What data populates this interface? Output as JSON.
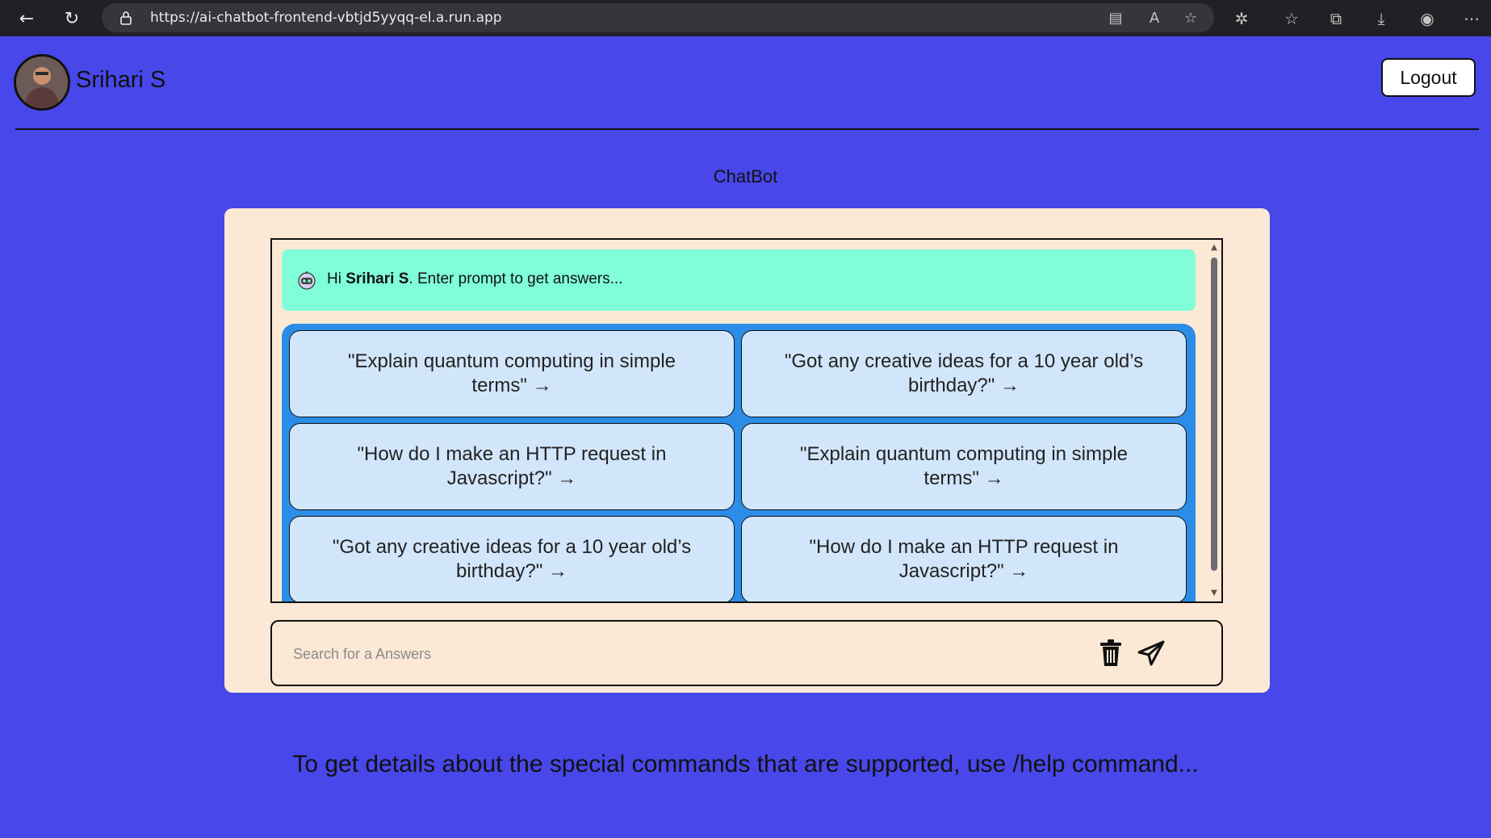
{
  "browser": {
    "url": "https://ai-chatbot-frontend-vbtjd5yyqq-el.a.run.app"
  },
  "header": {
    "user_name": "Srihari S",
    "logout_label": "Logout"
  },
  "page": {
    "title": "ChatBot",
    "help_text": "To get details about the special commands that are supported, use /help command..."
  },
  "chat": {
    "greeting_prefix": "Hi ",
    "greeting_name": "Srihari S",
    "greeting_suffix": ". Enter prompt to get answers...",
    "suggestions": [
      "\"Explain quantum computing in simple terms\" →",
      "\"Got any creative ideas for a 10 year old’s birthday?\" →",
      "\"How do I make an HTTP request in Javascript?\" →",
      "\"Explain quantum computing in simple terms\" →",
      "\"Got any creative ideas for a 10 year old’s birthday?\" →",
      "\"How do I make an HTTP request in Javascript?\" →"
    ]
  },
  "input": {
    "placeholder": "Search for a Answers",
    "value": ""
  },
  "colors": {
    "page_bg": "#4747ea",
    "card_bg": "#fbe9d6",
    "greeting_bg": "#7ffed7",
    "suggestions_bg": "#2b8de8",
    "suggestion_bg": "#d2e6fb"
  },
  "icons": {
    "back": "back-arrow-icon",
    "refresh": "refresh-icon",
    "lock": "lock-icon",
    "bot": "robot-icon",
    "trash": "trash-icon",
    "send": "send-icon"
  }
}
